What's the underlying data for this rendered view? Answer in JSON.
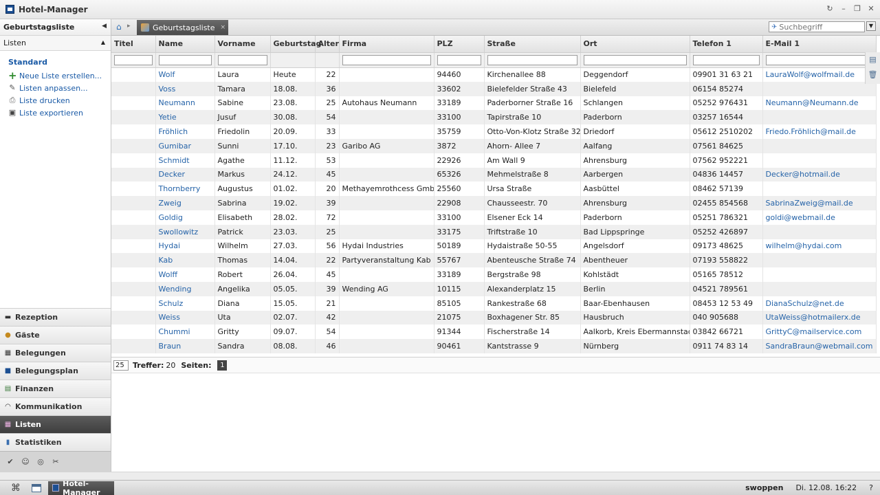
{
  "app": {
    "title": "Hotel-Manager"
  },
  "window_controls": [
    "↻",
    "–",
    "❐",
    "✕"
  ],
  "left": {
    "header": "Geburtstagsliste",
    "section": "Listen",
    "group_title": "Standard",
    "actions": [
      {
        "label": "Neue Liste erstellen...",
        "icon": "plus-icon"
      },
      {
        "label": "Listen anpassen...",
        "icon": "edit-icon"
      },
      {
        "label": "Liste drucken",
        "icon": "printer-icon"
      },
      {
        "label": "Liste exportieren",
        "icon": "export-icon"
      }
    ],
    "nav": [
      {
        "label": "Rezeption",
        "icon": "bell-icon"
      },
      {
        "label": "Gäste",
        "icon": "person-icon"
      },
      {
        "label": "Belegungen",
        "icon": "calendar-icon"
      },
      {
        "label": "Belegungsplan",
        "icon": "plan-icon"
      },
      {
        "label": "Finanzen",
        "icon": "money-icon"
      },
      {
        "label": "Kommunikation",
        "icon": "signal-icon"
      },
      {
        "label": "Listen",
        "icon": "list-icon"
      },
      {
        "label": "Statistiken",
        "icon": "chart-icon"
      }
    ],
    "active_nav": "Listen"
  },
  "tab": {
    "label": "Geburtstagsliste",
    "close": "×"
  },
  "search": {
    "placeholder": "Suchbegriff"
  },
  "table": {
    "columns": [
      "Titel",
      "Name",
      "Vorname",
      "Geburtstag",
      "Alter",
      "Firma",
      "PLZ",
      "Straße",
      "Ort",
      "Telefon 1",
      "E-Mail 1"
    ],
    "rows": [
      [
        "",
        "Wolf",
        "Laura",
        "Heute",
        "22",
        "",
        "94460",
        "Kirchenallee 88",
        "Deggendorf",
        "09901 31 63 21",
        "LauraWolf@wolfmail.de"
      ],
      [
        "",
        "Voss",
        "Tamara",
        "18.08.",
        "36",
        "",
        "33602",
        "Bielefelder Straße 43",
        "Bielefeld",
        "06154 85274",
        ""
      ],
      [
        "",
        "Neumann",
        "Sabine",
        "23.08.",
        "25",
        "Autohaus Neumann",
        "33189",
        "Paderborner Straße 16",
        "Schlangen",
        "05252 976431",
        "Neumann@Neumann.de"
      ],
      [
        "",
        "Yetie",
        "Jusuf",
        "30.08.",
        "54",
        "",
        "33100",
        "Tapirstraße 10",
        "Paderborn",
        "03257 16544",
        ""
      ],
      [
        "",
        "Fröhlich",
        "Friedolin",
        "20.09.",
        "33",
        "",
        "35759",
        "Otto-Von-Klotz Straße 32",
        "Driedorf",
        "05612 2510202",
        "Friedo.Fröhlich@mail.de"
      ],
      [
        "",
        "Gumibar",
        "Sunni",
        "17.10.",
        "23",
        "Garibo AG",
        "3872",
        "Ahorn- Allee 7",
        "Aalfang",
        "07561 84625",
        ""
      ],
      [
        "",
        "Schmidt",
        "Agathe",
        "11.12.",
        "53",
        "",
        "22926",
        "Am Wall 9",
        "Ahrensburg",
        "07562 952221",
        ""
      ],
      [
        "",
        "Decker",
        "Markus",
        "24.12.",
        "45",
        "",
        "65326",
        "Mehmelstraße 8",
        "Aarbergen",
        "04836 14457",
        "Decker@hotmail.de"
      ],
      [
        "",
        "Thornberry",
        "Augustus",
        "01.02.",
        "20",
        "Methayemrothcess GmbH",
        "25560",
        "Ursa Straße",
        "Aasbüttel",
        "08462 57139",
        ""
      ],
      [
        "",
        "Zweig",
        "Sabrina",
        "19.02.",
        "39",
        "",
        "22908",
        "Chausseestr. 70",
        "Ahrensburg",
        "02455 854568",
        "SabrinaZweig@mail.de"
      ],
      [
        "",
        "Goldig",
        "Elisabeth",
        "28.02.",
        "72",
        "",
        "33100",
        "Elsener Eck 14",
        "Paderborn",
        "05251 786321",
        "goldi@webmail.de"
      ],
      [
        "",
        "Swollowitz",
        "Patrick",
        "23.03.",
        "25",
        "",
        "33175",
        "Triftstraße 10",
        "Bad Lippspringe",
        "05252 426897",
        ""
      ],
      [
        "",
        "Hydai",
        "Wilhelm",
        "27.03.",
        "56",
        "Hydai Industries",
        "50189",
        "Hydaistraße 50-55",
        "Angelsdorf",
        "09173 48625",
        "wilhelm@hydai.com"
      ],
      [
        "",
        "Kab",
        "Thomas",
        "14.04.",
        "22",
        "Partyveranstaltung Kab",
        "55767",
        "Abenteusche Straße 74",
        "Abentheuer",
        "07193 558822",
        ""
      ],
      [
        "",
        "Wolff",
        "Robert",
        "26.04.",
        "45",
        "",
        "33189",
        "Bergstraße 98",
        "Kohlstädt",
        "05165 78512",
        ""
      ],
      [
        "",
        "Wending",
        "Angelika",
        "05.05.",
        "39",
        "Wending AG",
        "10115",
        "Alexanderplatz 15",
        "Berlin",
        "04521 789561",
        ""
      ],
      [
        "",
        "Schulz",
        "Diana",
        "15.05.",
        "21",
        "",
        "85105",
        "Rankestraße 68",
        "Baar-Ebenhausen",
        "08453 12 53 49",
        "DianaSchulz@net.de"
      ],
      [
        "",
        "Weiss",
        "Uta",
        "02.07.",
        "42",
        "",
        "21075",
        "Boxhagener Str. 85",
        "Hausbruch",
        "040 905688",
        "UtaWeiss@hotmailerx.de"
      ],
      [
        "",
        "Chummi",
        "Gritty",
        "09.07.",
        "54",
        "",
        "91344",
        "Fischerstraße 14",
        "Aalkorb, Kreis Ebermannstadt",
        "03842 66721",
        "GrittyC@mailservice.com"
      ],
      [
        "",
        "Braun",
        "Sandra",
        "08.08.",
        "46",
        "",
        "90461",
        "Kantstrasse 9",
        "Nürnberg",
        "0911 74 83 14",
        "SandraBraun@webmail.com"
      ]
    ]
  },
  "pager": {
    "page_size": "25",
    "hits_label": "Treffer:",
    "hits": "20",
    "pages_label": "Seiten:",
    "current_page": "1"
  },
  "taskbar": {
    "task_label": "Hotel-Manager",
    "user": "swoppen",
    "datetime": "Di. 12.08. 16:22",
    "help": "?"
  }
}
